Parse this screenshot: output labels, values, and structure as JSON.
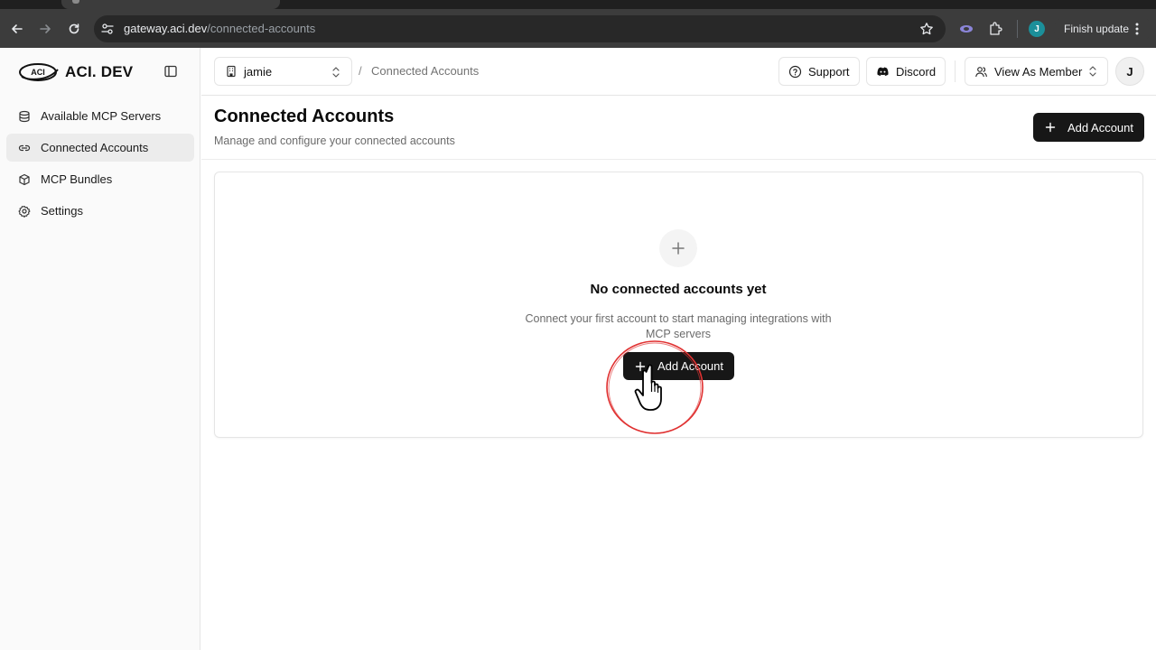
{
  "browser": {
    "url_host": "gateway.aci.dev",
    "url_path": "/connected-accounts",
    "profile_initial": "J",
    "finish_update_label": "Finish update"
  },
  "sidebar": {
    "logo_badge": "ACI",
    "logo_text": "ACI. DEV",
    "items": [
      {
        "label": "Available MCP Servers",
        "icon": "database-icon",
        "active": false
      },
      {
        "label": "Connected Accounts",
        "icon": "link-icon",
        "active": true
      },
      {
        "label": "MCP Bundles",
        "icon": "box-icon",
        "active": false
      },
      {
        "label": "Settings",
        "icon": "gear-icon",
        "active": false
      }
    ]
  },
  "header": {
    "org_name": "jamie",
    "breadcrumb_sep": "/",
    "breadcrumb_current": "Connected Accounts",
    "support_label": "Support",
    "discord_label": "Discord",
    "view_as_label": "View As Member",
    "avatar_initial": "J"
  },
  "page": {
    "title": "Connected Accounts",
    "subtitle": "Manage and configure your connected accounts",
    "add_account_label": "Add Account"
  },
  "empty_state": {
    "title": "No connected accounts yet",
    "description": "Connect your first account to start managing integrations with MCP servers",
    "add_account_label": "Add Account"
  },
  "colors": {
    "primary": "#171717",
    "annotation_ring": "#e03131",
    "profile": "#1b8f9a"
  }
}
